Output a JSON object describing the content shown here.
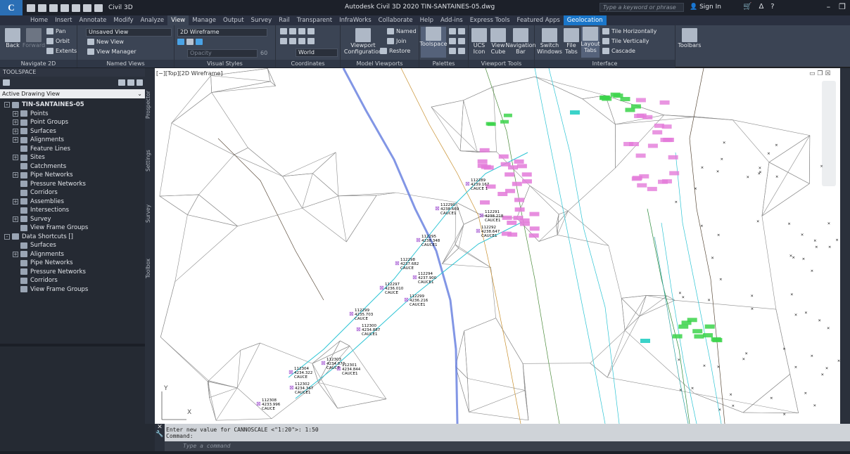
{
  "titlebar": {
    "app_logo": "C",
    "workspace": "Civil 3D",
    "title": "Autodesk Civil 3D 2020   TIN-SANTAINES-05.dwg",
    "search_placeholder": "Type a keyword or phrase",
    "sign_in": "Sign In"
  },
  "tabs": [
    "Home",
    "Insert",
    "Annotate",
    "Modify",
    "Analyze",
    "View",
    "Manage",
    "Output",
    "Survey",
    "Rail",
    "Transparent",
    "InfraWorks",
    "Collaborate",
    "Help",
    "Add-ins",
    "Express Tools",
    "Featured Apps",
    "Geolocation"
  ],
  "ribbon": {
    "navigate2d": {
      "title": "Navigate 2D",
      "back": "Back",
      "forward": "Forward",
      "pan": "Pan",
      "orbit": "Orbit",
      "extents": "Extents"
    },
    "named_views": {
      "title": "Named Views",
      "unsaved": "Unsaved View",
      "new_view": "New View",
      "view_manager": "View Manager"
    },
    "visual_styles": {
      "title": "Visual Styles",
      "style": "2D Wireframe",
      "opacity_label": "Opacity",
      "opacity_value": "60"
    },
    "coordinates": {
      "title": "Coordinates",
      "world": "World"
    },
    "model_viewports": {
      "title": "Model Viewports",
      "viewport_config": "Viewport Configuration",
      "named": "Named",
      "join": "Join",
      "restore": "Restore"
    },
    "palettes": {
      "title": "Palettes",
      "toolspace": "Toolspace"
    },
    "viewport_tools": {
      "title": "Viewport Tools",
      "ucs_icon": "UCS Icon",
      "view_cube": "View Cube",
      "navigation_bar": "Navigation Bar"
    },
    "interface": {
      "title": "Interface",
      "switch_windows": "Switch Windows",
      "file_tabs": "File Tabs",
      "layout_tabs": "Layout Tabs",
      "tile_h": "Tile Horizontally",
      "tile_v": "Tile Vertically",
      "cascade": "Cascade",
      "toolbars": "Toolbars"
    }
  },
  "toolspace": {
    "header": "TOOLSPACE",
    "view_dropdown": "Active Drawing View",
    "tabs": [
      "Prospector",
      "Settings",
      "Survey",
      "Toolbox"
    ],
    "tree": [
      {
        "label": "TIN-SANTAINES-05",
        "level": 0,
        "exp": "-",
        "root": true
      },
      {
        "label": "Points",
        "level": 1,
        "exp": "+"
      },
      {
        "label": "Point Groups",
        "level": 1,
        "exp": "+"
      },
      {
        "label": "Surfaces",
        "level": 1,
        "exp": "+"
      },
      {
        "label": "Alignments",
        "level": 1,
        "exp": "+"
      },
      {
        "label": "Feature Lines",
        "level": 1,
        "exp": ""
      },
      {
        "label": "Sites",
        "level": 1,
        "exp": "+"
      },
      {
        "label": "Catchments",
        "level": 1,
        "exp": ""
      },
      {
        "label": "Pipe Networks",
        "level": 1,
        "exp": "+"
      },
      {
        "label": "Pressure Networks",
        "level": 1,
        "exp": ""
      },
      {
        "label": "Corridors",
        "level": 1,
        "exp": ""
      },
      {
        "label": "Assemblies",
        "level": 1,
        "exp": "+"
      },
      {
        "label": "Intersections",
        "level": 1,
        "exp": ""
      },
      {
        "label": "Survey",
        "level": 1,
        "exp": "+"
      },
      {
        "label": "View Frame Groups",
        "level": 1,
        "exp": ""
      },
      {
        "label": "Data Shortcuts []",
        "level": 0,
        "exp": "-"
      },
      {
        "label": "Surfaces",
        "level": 1,
        "exp": ""
      },
      {
        "label": "Alignments",
        "level": 1,
        "exp": "+"
      },
      {
        "label": "Pipe Networks",
        "level": 1,
        "exp": ""
      },
      {
        "label": "Pressure Networks",
        "level": 1,
        "exp": ""
      },
      {
        "label": "Corridors",
        "level": 1,
        "exp": ""
      },
      {
        "label": "View Frame Groups",
        "level": 1,
        "exp": ""
      }
    ]
  },
  "viewport": {
    "label": "[−][Top][2D Wireframe]",
    "ucs_y": "Y",
    "ucs_x": "X",
    "points": [
      {
        "id": "112289",
        "elev": "4239.167",
        "desc": "CAUCE 1"
      },
      {
        "id": "112290",
        "elev": "4238.669",
        "desc": "CAUCE1"
      },
      {
        "id": "112291",
        "elev": "4238.218",
        "desc": "CAUCE1"
      },
      {
        "id": "112292",
        "elev": "4238.647",
        "desc": "CAUCE1"
      },
      {
        "id": "112295",
        "elev": "4238.348",
        "desc": "CAUCE1"
      },
      {
        "id": "112298",
        "elev": "4237.682",
        "desc": "CAUCE"
      },
      {
        "id": "112294",
        "elev": "4237.900",
        "desc": "CAUCE1"
      },
      {
        "id": "112297",
        "elev": "4236.010",
        "desc": "CAUCE"
      },
      {
        "id": "112299",
        "elev": "4236.216",
        "desc": "CAUCE1"
      },
      {
        "id": "112299",
        "elev": "4235.703",
        "desc": "CAUCE"
      },
      {
        "id": "112300",
        "elev": "4234.887",
        "desc": "CAUCE1"
      },
      {
        "id": "112303",
        "elev": "4234.873",
        "desc": "CAUCE"
      },
      {
        "id": "112301",
        "elev": "4234.844",
        "desc": "CAUCE1"
      },
      {
        "id": "112304",
        "elev": "4234.322",
        "desc": "CAUCE"
      },
      {
        "id": "112302",
        "elev": "4234.347",
        "desc": "CAUCE1"
      },
      {
        "id": "112308",
        "elev": "4233.996",
        "desc": "CAUCE"
      }
    ]
  },
  "command": {
    "history": "Enter new value for CANNOSCALE <\"1:20\">: 1:50\nCommand:",
    "placeholder": "Type a command"
  }
}
